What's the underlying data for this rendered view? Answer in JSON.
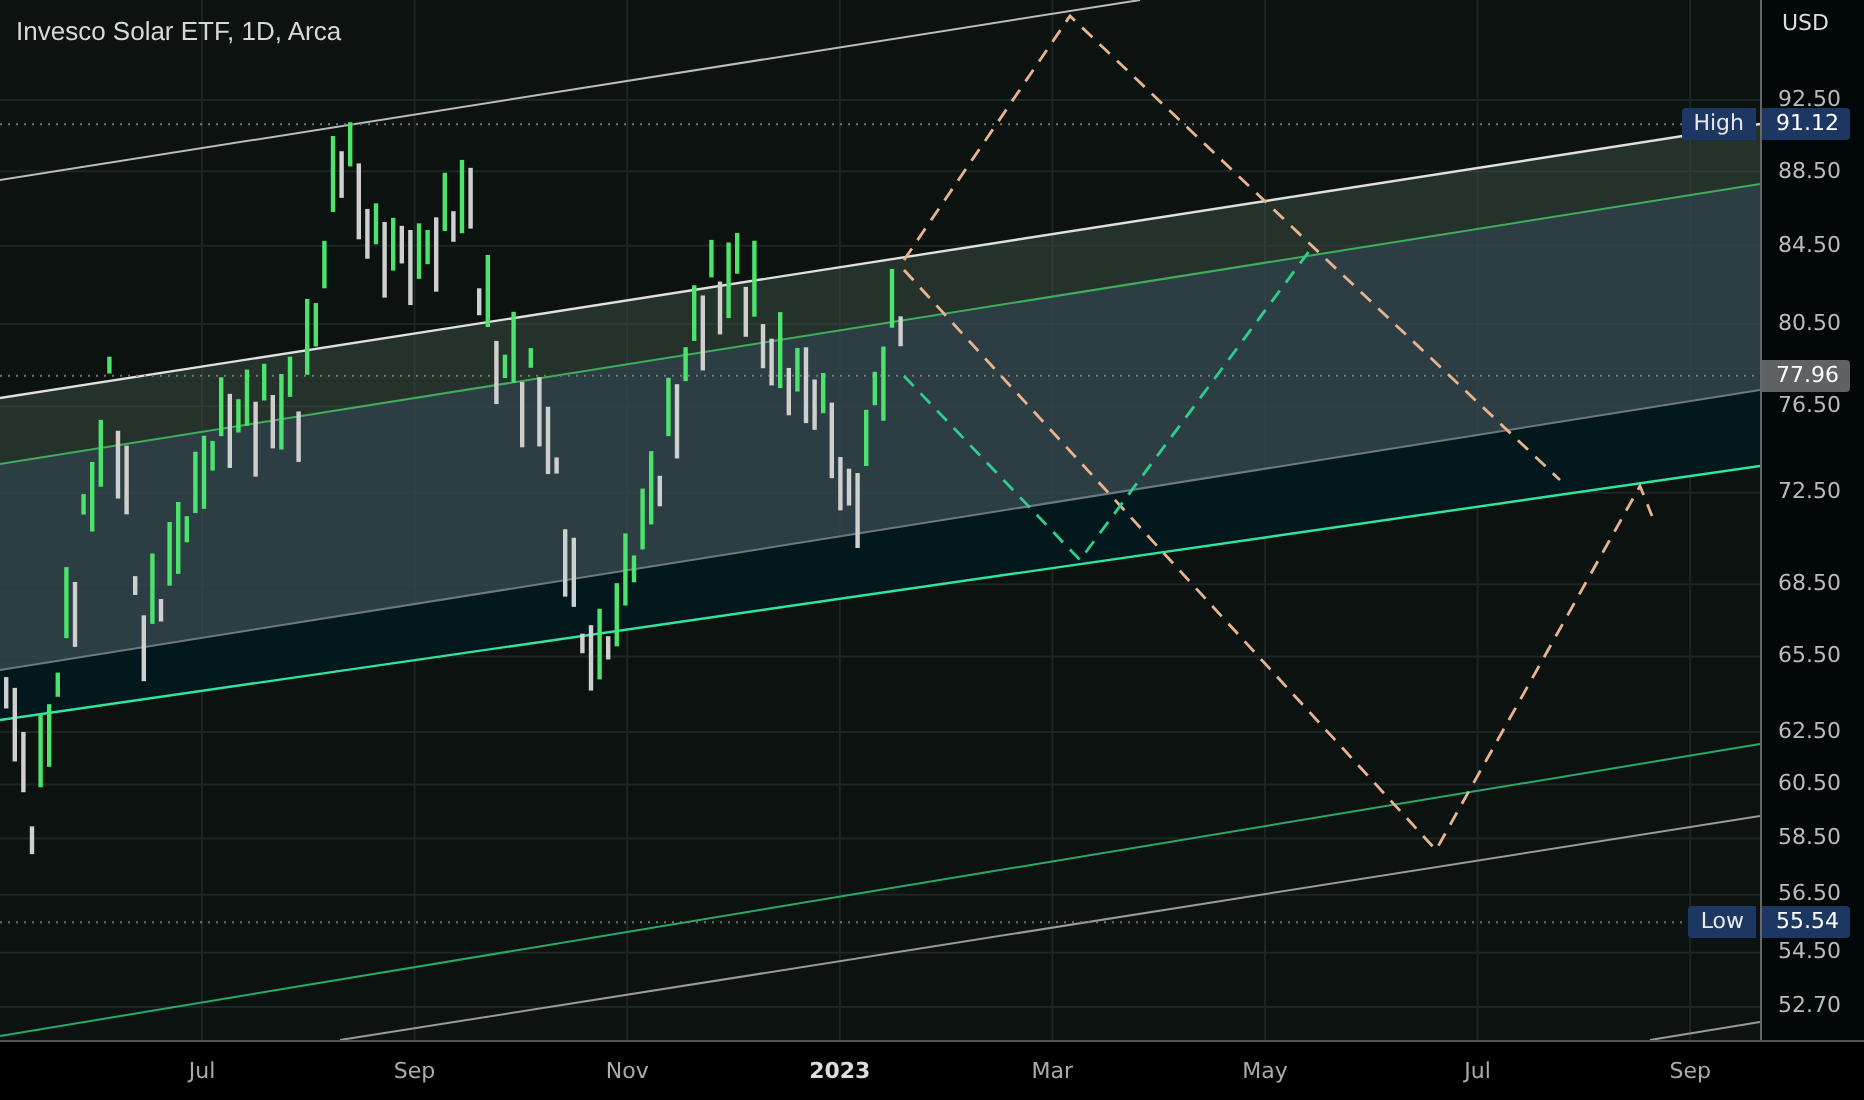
{
  "chart": {
    "title": "Invesco Solar ETF, 1D, Arca",
    "currency": "USD",
    "price_ticks": [
      "92.50",
      "88.50",
      "84.50",
      "80.50",
      "76.50",
      "72.50",
      "68.50",
      "65.50",
      "62.50",
      "60.50",
      "58.50",
      "56.50",
      "54.50",
      "52.70"
    ],
    "time_ticks": [
      {
        "label": "Jul",
        "kind": "month"
      },
      {
        "label": "Sep",
        "kind": "month"
      },
      {
        "label": "Nov",
        "kind": "month"
      },
      {
        "label": "2023",
        "kind": "year"
      },
      {
        "label": "Mar",
        "kind": "month"
      },
      {
        "label": "May",
        "kind": "month"
      },
      {
        "label": "Jul",
        "kind": "month"
      },
      {
        "label": "Sep",
        "kind": "month"
      }
    ],
    "markers": [
      {
        "kind": "high",
        "label": "High",
        "value": "91.12"
      },
      {
        "kind": "last",
        "value": "77.96"
      },
      {
        "kind": "low",
        "label": "Low",
        "value": "55.54"
      }
    ]
  }
}
